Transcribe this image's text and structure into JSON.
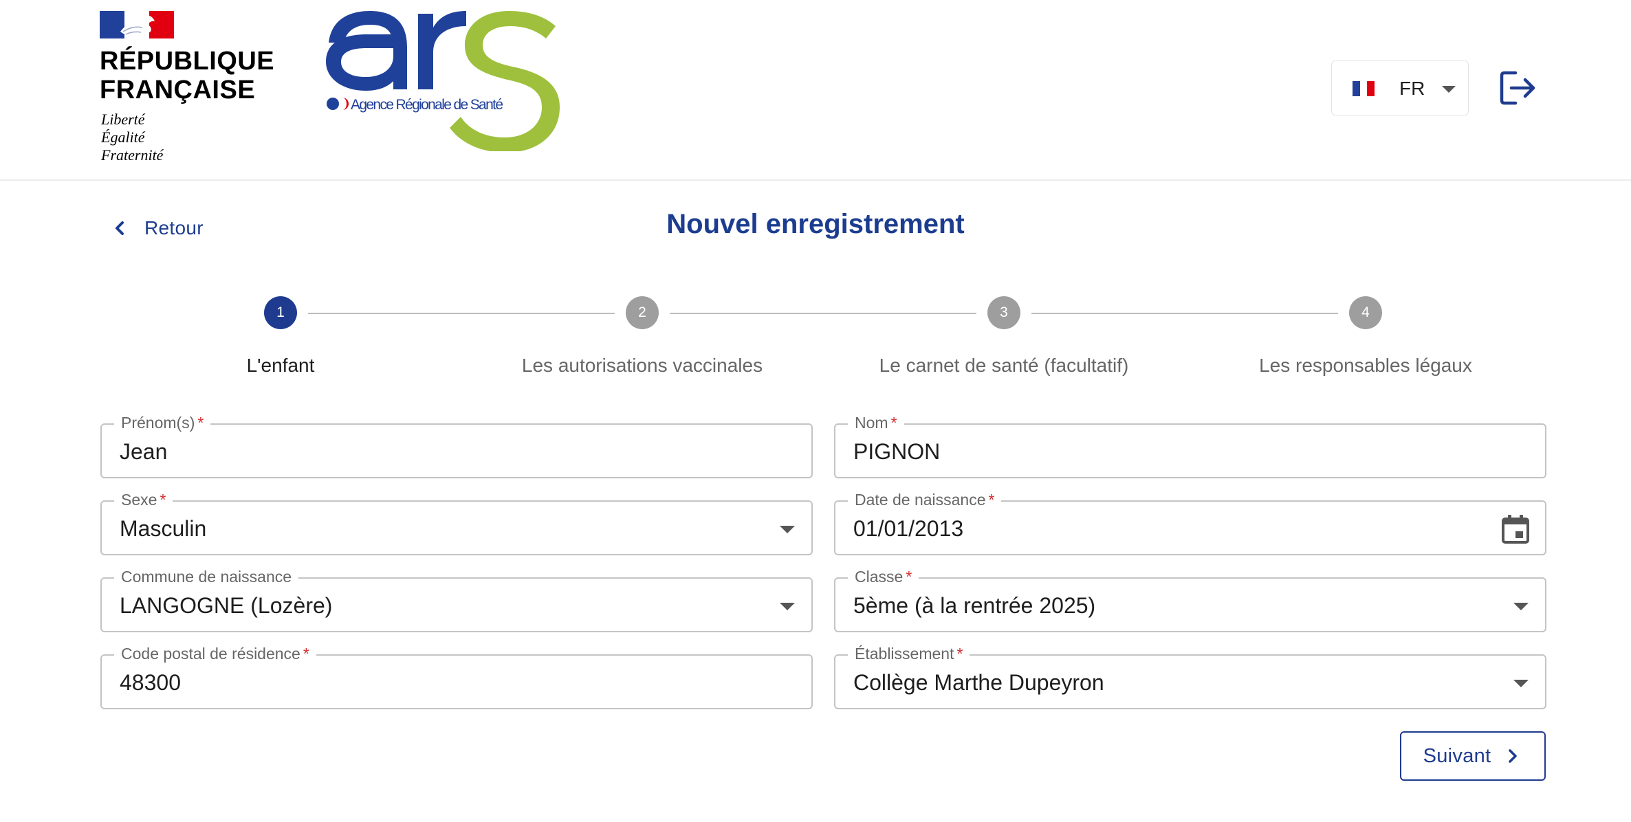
{
  "header": {
    "republic_name_line1": "RÉPUBLIQUE",
    "republic_name_line2": "FRANÇAISE",
    "motto_line1": "Liberté",
    "motto_line2": "Égalité",
    "motto_line3": "Fraternité",
    "ars_agency_name": "Agence Régionale de Santé",
    "language": "FR",
    "logout_icon": "logout-icon"
  },
  "colors": {
    "brand_blue": "#1f3b8f",
    "ars_blue": "#20419a",
    "ars_green": "#9ec03c",
    "required_red": "#d32f2f",
    "inactive_step": "#9e9e9e"
  },
  "nav": {
    "back_label": "Retour",
    "page_title": "Nouvel enregistrement"
  },
  "stepper": {
    "current_step": 1,
    "steps": [
      {
        "number": "1",
        "label": "L'enfant"
      },
      {
        "number": "2",
        "label": "Les autorisations vaccinales"
      },
      {
        "number": "3",
        "label": "Le carnet de santé (facultatif)"
      },
      {
        "number": "4",
        "label": "Les responsables légaux"
      }
    ]
  },
  "form": {
    "prenom": {
      "label": "Prénom(s)",
      "required_mark": "*",
      "value": "Jean"
    },
    "nom": {
      "label": "Nom",
      "required_mark": "*",
      "value": "PIGNON"
    },
    "sexe": {
      "label": "Sexe",
      "required_mark": "*",
      "value": "Masculin"
    },
    "date_naissance": {
      "label": "Date de naissance",
      "required_mark": "*",
      "value": "01/01/2013"
    },
    "commune": {
      "label": "Commune de naissance",
      "value": "LANGOGNE (Lozère)"
    },
    "classe": {
      "label": "Classe",
      "required_mark": "*",
      "value": "5ème (à la rentrée 2025)"
    },
    "code_postal": {
      "label": "Code postal de résidence",
      "required_mark": "*",
      "value": "48300"
    },
    "etablissement": {
      "label": "Établissement",
      "required_mark": "*",
      "value": "Collège Marthe Dupeyron"
    }
  },
  "actions": {
    "next_label": "Suivant"
  }
}
